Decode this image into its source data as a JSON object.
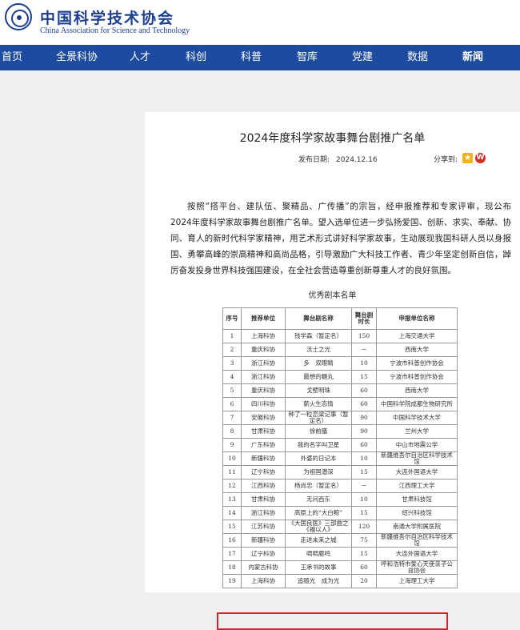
{
  "header": {
    "logo_cn": "中国科学技术协会",
    "logo_en": "China Association for Science and Technology"
  },
  "nav": {
    "items": [
      {
        "label": "首页"
      },
      {
        "label": "全景科协"
      },
      {
        "label": "人才"
      },
      {
        "label": "科创"
      },
      {
        "label": "科普"
      },
      {
        "label": "智库"
      },
      {
        "label": "党建"
      },
      {
        "label": "数据"
      },
      {
        "label": "新闻",
        "active": true
      }
    ]
  },
  "article": {
    "title": "2024年度科学家故事舞台剧推广名单",
    "date_label": "发布日期:",
    "date_value": "2024.12.16",
    "share_label": "分享到:",
    "paragraph": "按照“搭平台、建队伍、聚精品、广传播”的宗旨，经申报推荐和专家评审，现公布2024年度科学家故事舞台剧推广名单。望入选单位进一步弘扬爱国、创新、求实、奉献、协同、育人的新时代科学家精神，用艺术形式讲好科学家故事，生动展现我国科研人员以身报国、勇攀高峰的崇高精神和高尚品格，引导激励广大科技工作者、青少年坚定创新自信，踔厉奋发投身世界科技强国建设，在全社会营造尊重创新尊重人才的良好氛围。",
    "list_title": "优秀剧本名单"
  },
  "table": {
    "headers": [
      "序号",
      "推荐单位",
      "舞台剧名称",
      "舞台剧时长",
      "申报单位名称"
    ],
    "rows": [
      [
        "1",
        "上海科协",
        "钱学森（暂定名）",
        "150",
        "上海交通大学"
      ],
      [
        "2",
        "重庆科协",
        "沃土之光",
        "－",
        "西南大学"
      ],
      [
        "3",
        "浙江科协",
        "多　双眼睛",
        "10",
        "宁波市科普创作协会"
      ],
      [
        "4",
        "浙江科协",
        "最想的糖丸",
        "15",
        "宁波市科普创作协会"
      ],
      [
        "5",
        "重庆科协",
        "戈壁明珠",
        "60",
        "西南大学"
      ],
      [
        "6",
        "四川科协",
        "薪火生态情",
        "60",
        "中国科学院成都生物研究所"
      ],
      [
        "7",
        "安徽科协",
        "种了一粒恋梁记事（暂定名）",
        "90",
        "中国科学技术大学"
      ],
      [
        "8",
        "甘肃科协",
        "徐前膳",
        "90",
        "兰州大学"
      ],
      [
        "9",
        "广东科协",
        "我的名字叫卫星",
        "60",
        "中山市地震公学"
      ],
      [
        "10",
        "新疆科协",
        "外婆的日记本",
        "10",
        "新疆维吾尔自治区科学技术馆"
      ],
      [
        "11",
        "辽宁科协",
        "为祖国潜深",
        "15",
        "大连外国语大学"
      ],
      [
        "12",
        "江西科协",
        "杨尚忠（暂定名）",
        "－",
        "江西理工大学"
      ],
      [
        "13",
        "甘肃科协",
        "无问西东",
        "10",
        "甘肃科技馆"
      ],
      [
        "14",
        "浙江科协",
        "高原上的“大白鲸”",
        "15",
        "绍兴科技馆"
      ],
      [
        "15",
        "江苏科协",
        "《大国良医》三部曲之《福以人》",
        "120",
        "南通大学附属医院"
      ],
      [
        "16",
        "新疆科协",
        "走进未来之城",
        "75",
        "新疆维吾尔自治区科学技术馆"
      ],
      [
        "17",
        "辽宁科协",
        "啁啁鹿鸣",
        "15",
        "大连外国语大学"
      ],
      [
        "18",
        "内蒙古科协",
        "王承书的故事",
        "60",
        "呼和浩特市爱心天使亲子公益协会"
      ],
      [
        "19",
        "上海科协",
        "追随光　成为光",
        "20",
        "上海理工大学"
      ]
    ]
  },
  "colors": {
    "nav_bg": "#1d4ba0",
    "brand_blue": "#1c3f8f",
    "highlight": "#d8212a"
  }
}
